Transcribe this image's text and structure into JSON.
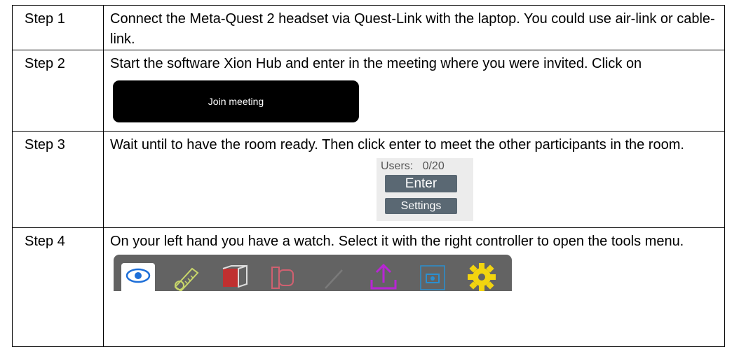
{
  "steps": [
    {
      "label": "Step 1",
      "text": "Connect the Meta-Quest 2 headset via Quest-Link with the laptop. You could use air-link or cable-link."
    },
    {
      "label": "Step 2",
      "text": "Start the software Xion Hub and enter in the meeting where you were invited. Click on",
      "button_label": "Join meeting"
    },
    {
      "label": "Step 3",
      "text": "Wait until to have the room ready. Then click enter to meet the other participants in the room.",
      "panel": {
        "users_label": "Users:",
        "users_count": "0/20",
        "enter_label": "Enter",
        "settings_label": "Settings"
      }
    },
    {
      "label": "Step 4",
      "text": "On your left hand you have a watch. Select it with the right controller to open the tools menu."
    }
  ],
  "tools_menu": {
    "icons": [
      "eye-icon",
      "measure-tape-icon",
      "cube-icon",
      "outline-shape-icon",
      "pen-icon",
      "upload-icon",
      "camera-icon",
      "gear-icon"
    ],
    "colors": {
      "bar": "#636363",
      "eye": "#1e6fd8",
      "tape": "#c8d66a",
      "cube": "#c03030",
      "upload": "#b825d4",
      "camera": "#2a8fd0",
      "gear": "#f2d40f"
    }
  }
}
